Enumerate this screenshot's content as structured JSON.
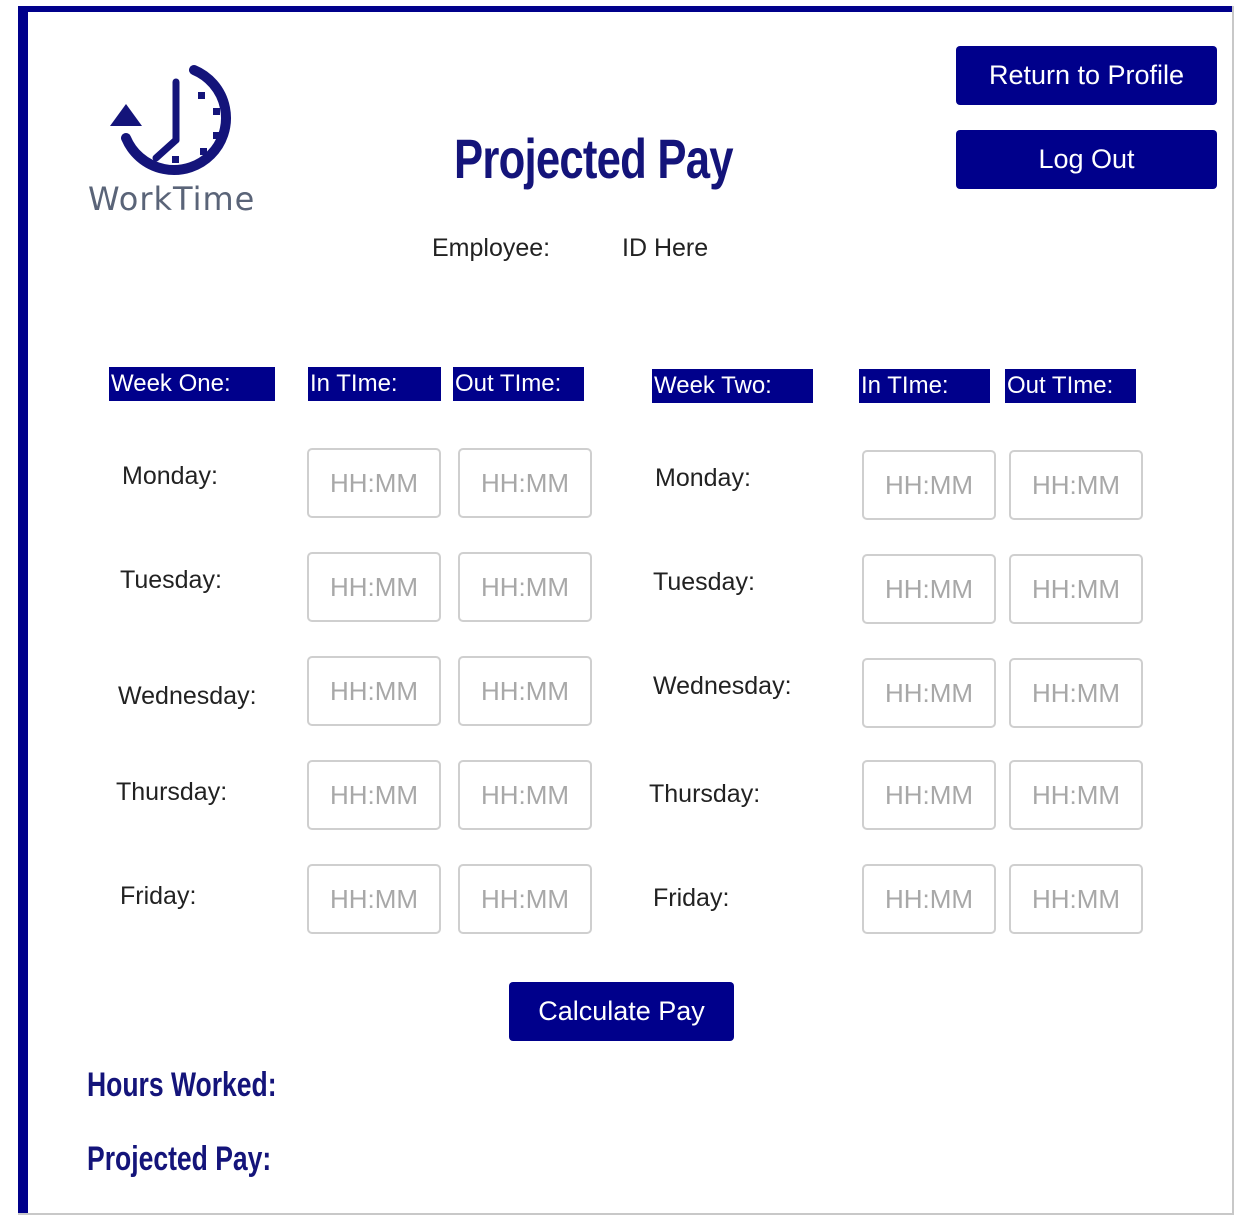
{
  "logo": {
    "text": "WorkTime",
    "icon": "clock-rewind-icon",
    "color": "#14147a"
  },
  "page_title": "Projected Pay",
  "employee": {
    "label": "Employee:",
    "id": "ID Here"
  },
  "buttons": {
    "return": "Return to Profile",
    "logout": "Log Out",
    "calculate": "Calculate Pay"
  },
  "week_one": {
    "header": "Week One:",
    "in_header": "In TIme:",
    "out_header": "Out TIme:",
    "days": [
      "Monday:",
      "Tuesday:",
      "Wednesday:",
      "Thursday:",
      "Friday:"
    ]
  },
  "week_two": {
    "header": "Week Two:",
    "in_header": "In TIme:",
    "out_header": "Out TIme:",
    "days": [
      "Monday:",
      "Tuesday:",
      "Wednesday:",
      "Thursday:",
      "Friday:"
    ]
  },
  "time_placeholder": "HH:MM",
  "results": {
    "hours_worked": "Hours Worked:",
    "projected_pay": "Projected Pay:"
  },
  "colors": {
    "accent": "#00008b",
    "title": "#14147a"
  }
}
